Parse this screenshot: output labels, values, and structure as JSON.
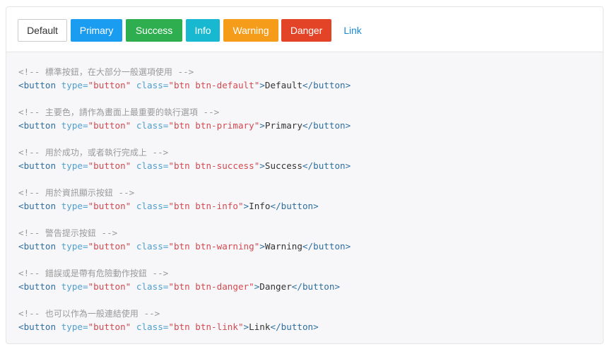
{
  "buttons": [
    {
      "name": "default-button",
      "label": "Default",
      "cls": "btn-default"
    },
    {
      "name": "primary-button",
      "label": "Primary",
      "cls": "btn-primary"
    },
    {
      "name": "success-button",
      "label": "Success",
      "cls": "btn-success"
    },
    {
      "name": "info-button",
      "label": "Info",
      "cls": "btn-info"
    },
    {
      "name": "warning-button",
      "label": "Warning",
      "cls": "btn-warning"
    },
    {
      "name": "danger-button",
      "label": "Danger",
      "cls": "btn-danger"
    },
    {
      "name": "link-button",
      "label": "Link",
      "cls": "btn-link"
    }
  ],
  "code": [
    {
      "comment": "標準按鈕，在大部分一般選項使用",
      "class_value": "btn btn-default",
      "text": "Default"
    },
    {
      "comment": "主要色，請作為畫面上最重要的執行選項",
      "class_value": "btn btn-primary",
      "text": "Primary"
    },
    {
      "comment": "用於成功，或者執行完成上",
      "class_value": "btn btn-success",
      "text": "Success"
    },
    {
      "comment": "用於資訊顯示按鈕",
      "class_value": "btn btn-info",
      "text": "Info"
    },
    {
      "comment": "警告提示按鈕",
      "class_value": "btn btn-warning",
      "text": "Warning"
    },
    {
      "comment": "錯誤或是帶有危險動作按鈕",
      "class_value": "btn btn-danger",
      "text": "Danger"
    },
    {
      "comment": "也可以作為一般連結使用",
      "class_value": "btn btn-link",
      "text": "Link"
    }
  ],
  "tokens": {
    "comment_open": "<!-- ",
    "comment_close": " -->",
    "tag_open": "<button",
    "type_attr": "type=",
    "type_value": "\"button\"",
    "class_attr": "class=",
    "tag_close": "</button>",
    "gt": ">"
  },
  "colors": {
    "primary": "#1a9cf0",
    "success": "#2eae4f",
    "info": "#18b9d0",
    "warning": "#f59d1a",
    "danger": "#e34427",
    "link": "#1a8bd6"
  }
}
